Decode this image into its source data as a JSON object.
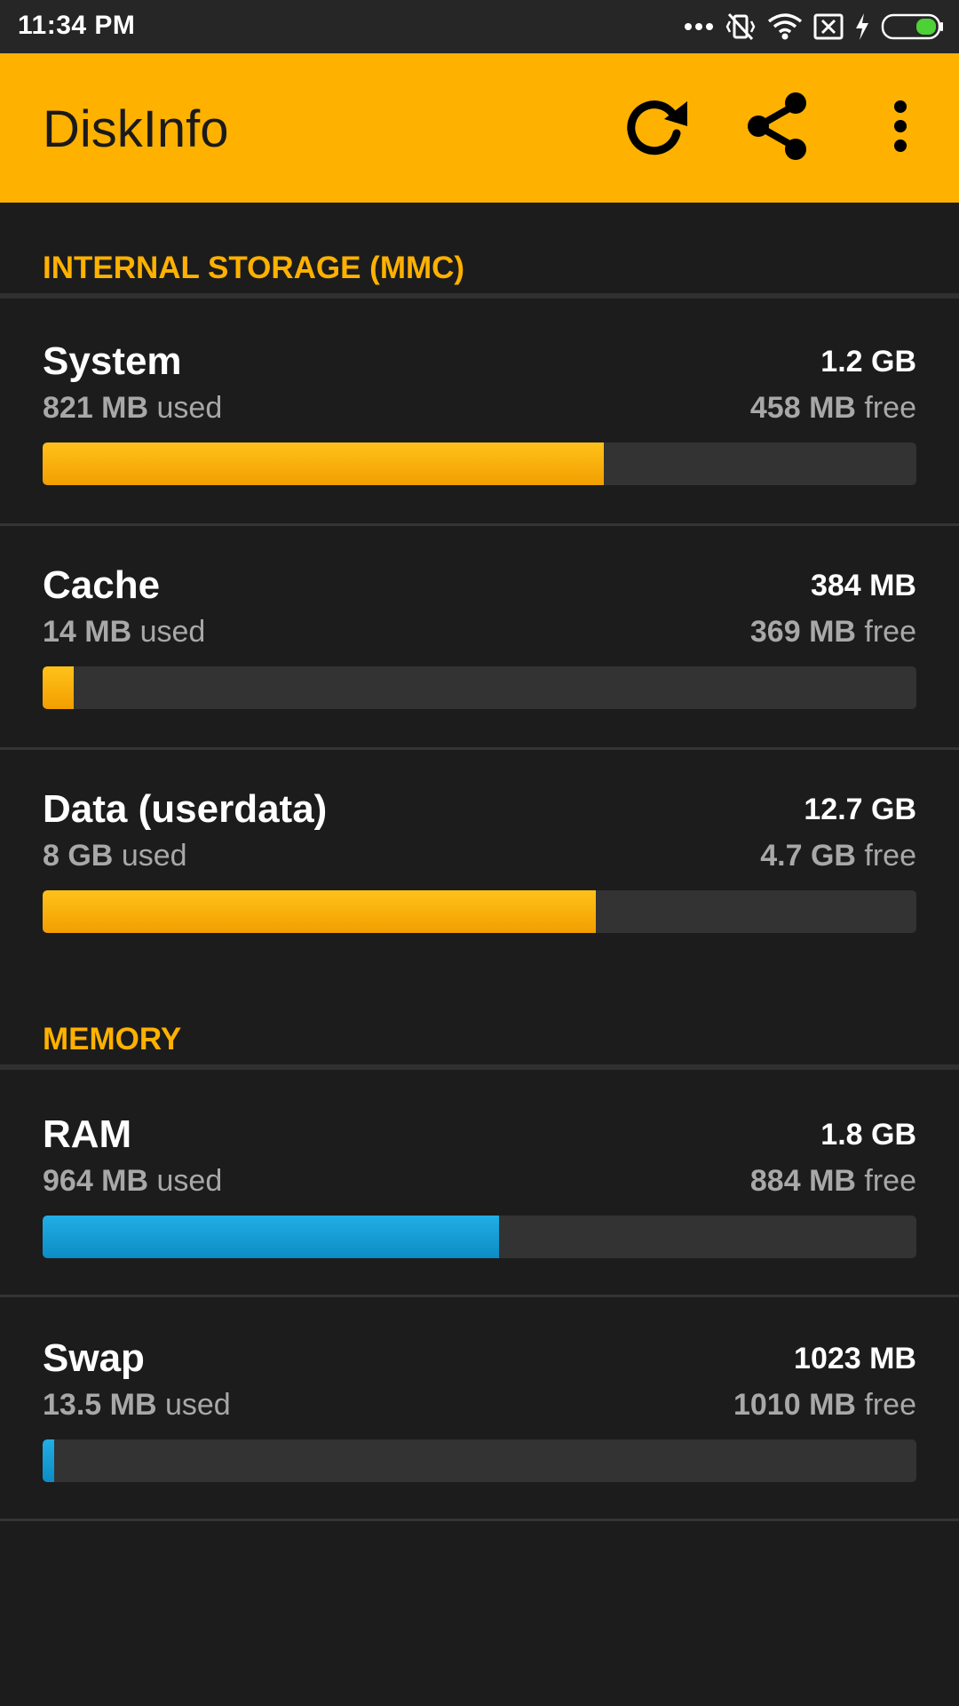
{
  "status_bar": {
    "time": "11:34 PM",
    "icons": [
      "more-dots-icon",
      "vibrate-off-icon",
      "wifi-icon",
      "no-sim-icon",
      "charging-icon",
      "battery-icon"
    ]
  },
  "app_bar": {
    "title": "DiskInfo",
    "background": "#ffb100",
    "actions": [
      "refresh-icon",
      "share-icon",
      "more-vert-icon"
    ]
  },
  "sections": [
    {
      "header": "INTERNAL STORAGE (MMC)",
      "accent": "#ffb100",
      "items": [
        {
          "name": "System",
          "total": "1.2 GB",
          "used_value": "821 MB",
          "used_suffix": "used",
          "free_value": "458 MB",
          "free_suffix": "free",
          "used_fraction": 0.642,
          "bar_color": "#ffb100"
        },
        {
          "name": "Cache",
          "total": "384 MB",
          "used_value": "14 MB",
          "used_suffix": "used",
          "free_value": "369 MB",
          "free_suffix": "free",
          "used_fraction": 0.036,
          "bar_color": "#ffb100"
        },
        {
          "name": "Data (userdata)",
          "total": "12.7 GB",
          "used_value": "8 GB",
          "used_suffix": "used",
          "free_value": "4.7 GB",
          "free_suffix": "free",
          "used_fraction": 0.633,
          "bar_color": "#ffb100"
        }
      ]
    },
    {
      "header": "MEMORY",
      "accent": "#ffb100",
      "items": [
        {
          "name": "RAM",
          "total": "1.8 GB",
          "used_value": "964 MB",
          "used_suffix": "used",
          "free_value": "884 MB",
          "free_suffix": "free",
          "used_fraction": 0.522,
          "bar_color": "#1a9fd8"
        },
        {
          "name": "Swap",
          "total": "1023 MB",
          "used_value": "13.5 MB",
          "used_suffix": "used",
          "free_value": "1010 MB",
          "free_suffix": "free",
          "used_fraction": 0.013,
          "bar_color": "#1a9fd8"
        }
      ]
    }
  ]
}
